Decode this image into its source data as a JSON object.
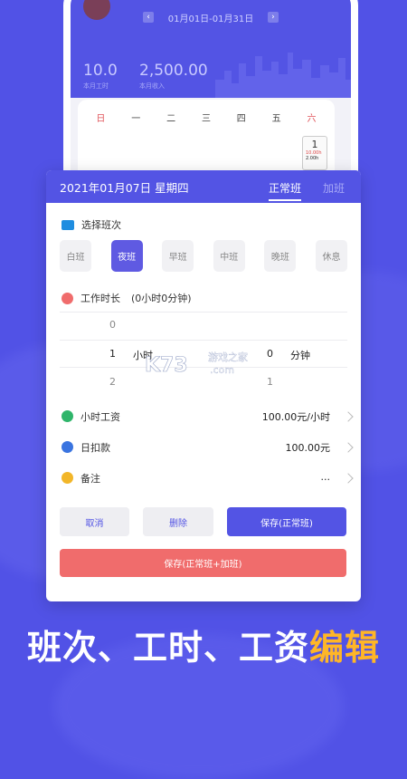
{
  "background": {
    "color": "#5152e6"
  },
  "calendar_preview": {
    "range_text": "01月01日-01月31日",
    "prev_icon": "chevron-left-icon",
    "next_icon": "chevron-right-icon",
    "stats": [
      {
        "value": "10.0",
        "label": "本月工时"
      },
      {
        "value": "2,500.00",
        "label": "本月收入"
      }
    ],
    "weekdays": [
      "日",
      "一",
      "二",
      "三",
      "四",
      "五",
      "六"
    ],
    "day_cell": {
      "day": "1",
      "line1": "10.00h",
      "line2": "2.00h"
    }
  },
  "modal": {
    "date_title": "2021年01月07日 星期四",
    "tabs": [
      {
        "label": "正常班",
        "active": true
      },
      {
        "label": "加班",
        "active": false
      }
    ],
    "shift_section": {
      "title": "选择班次",
      "icon": "briefcase-icon",
      "options": [
        {
          "label": "白班",
          "active": false
        },
        {
          "label": "夜班",
          "active": true
        },
        {
          "label": "早班",
          "active": false
        },
        {
          "label": "中班",
          "active": false
        },
        {
          "label": "晚班",
          "active": false
        },
        {
          "label": "休息",
          "active": false
        }
      ]
    },
    "work_hours": {
      "title": "工作时长",
      "summary": "(0小时0分钟)",
      "icon": "clock-icon",
      "hours_above": "0",
      "hours_selected": "1",
      "hours_unit": "小时",
      "hours_below": "2",
      "minutes_selected": "0",
      "minutes_unit": "分钟",
      "minutes_below": "1"
    },
    "rows": [
      {
        "label": "小时工资",
        "value": "100.00元/小时",
        "icon": "money-bag-icon",
        "color": "#2fb56a"
      },
      {
        "label": "日扣款",
        "value": "100.00元",
        "icon": "deduction-icon",
        "color": "#3a74e0"
      },
      {
        "label": "备注",
        "value": "...",
        "icon": "note-icon",
        "color": "#f2b629"
      }
    ],
    "buttons": {
      "cancel": "取消",
      "delete": "删除",
      "save_normal": "保存(正常班)",
      "save_all": "保存(正常班+加班)"
    }
  },
  "watermark": {
    "text1": "游戏之家",
    "text2": ".com",
    "logo": "K73"
  },
  "headline": {
    "part1": "班次、工时、工资",
    "part2": "编辑"
  },
  "colors": {
    "accent": "#5354e4",
    "danger": "#f06c6c",
    "highlight": "#ffb627"
  }
}
